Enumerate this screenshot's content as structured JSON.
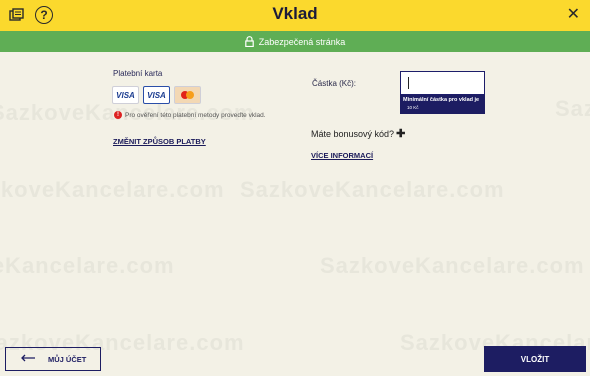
{
  "header": {
    "title": "Vklad",
    "history_icon": "history-icon",
    "help_icon": "help-icon",
    "help_glyph": "?",
    "close_glyph": "✕"
  },
  "secure_bar": {
    "text": "Zabezpečená stránka",
    "color": "#5fae55"
  },
  "watermark": "SazkoveKancelare.com",
  "payment": {
    "label": "Platební karta",
    "cards": [
      {
        "name": "VISA",
        "selected": false
      },
      {
        "name": "VISA",
        "selected": true
      },
      {
        "name": "MasterCard",
        "selected": false
      }
    ],
    "verify_note": "Pro ověření této platební metody proveďte vklad.",
    "change_method": "ZMĚNIT ZPŮSOB PLATBY"
  },
  "amount": {
    "label": "Částka (Kč):",
    "value": "",
    "tooltip_title": "Minimální částka pro vklad je",
    "tooltip_value": "10 Kč"
  },
  "bonus": {
    "label": "Máte bonusový kód?",
    "more_info": "VÍCE INFORMACÍ"
  },
  "footer": {
    "back_label": "MŮJ ÚČET",
    "submit_label": "VLOŽIT"
  },
  "colors": {
    "header": "#fbd92d",
    "primary": "#1d1d62",
    "background": "#f3f1e6"
  }
}
